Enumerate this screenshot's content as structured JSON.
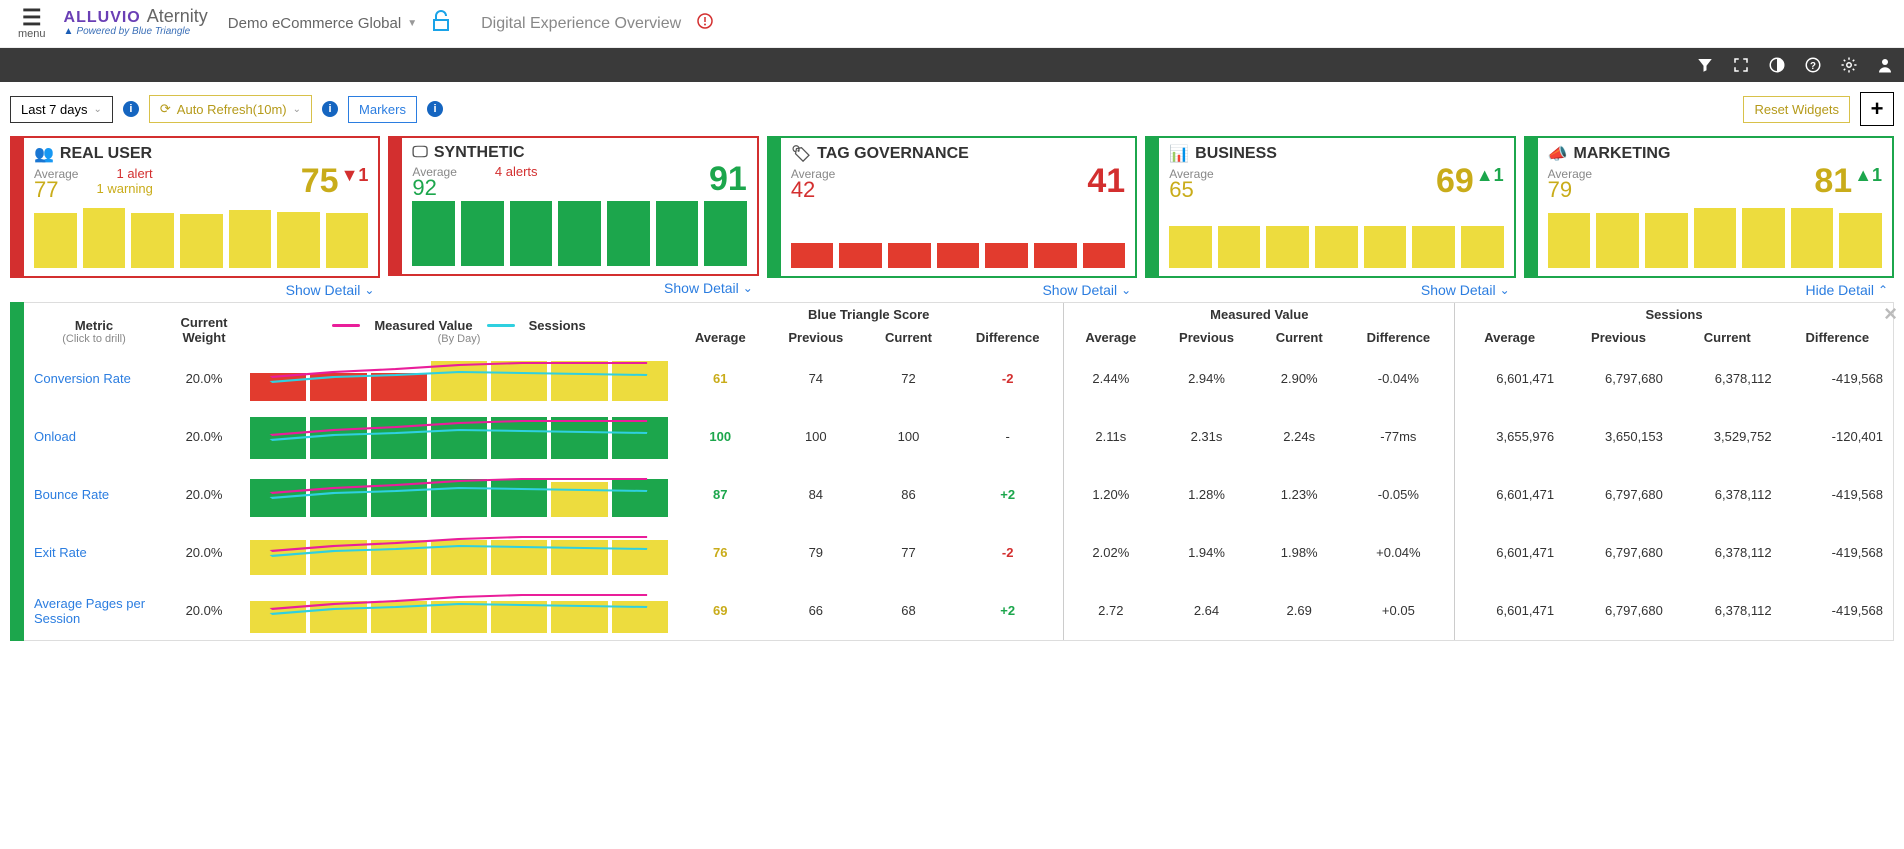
{
  "header": {
    "menu_label": "menu",
    "brand1": "ALLUVIO",
    "brand2": "Aternity",
    "powered": "Powered by Blue Triangle",
    "tenant": "Demo eCommerce Global",
    "page_title": "Digital Experience Overview"
  },
  "toolbar": {
    "daterange": "Last 7 days",
    "autorefresh": "Auto Refresh(10m)",
    "markers": "Markers",
    "reset": "Reset Widgets"
  },
  "cards": [
    {
      "id": "realuser",
      "title": "REAL USER",
      "icon": "users",
      "border": "red",
      "avgLabel": "Average",
      "avgVal": "77",
      "avgClass": "y",
      "alert": "1 alert",
      "warn": "1 warning",
      "bigVal": "75",
      "bigClass": "y",
      "trend": "▼1",
      "trendClass": "trend-dn r",
      "bars": [
        55,
        60,
        55,
        54,
        58,
        56,
        55
      ],
      "barClass": "y",
      "link": "Show Detail"
    },
    {
      "id": "synthetic",
      "title": "SYNTHETIC",
      "icon": "synth",
      "border": "red",
      "avgLabel": "Average",
      "avgVal": "92",
      "avgClass": "g",
      "alert": "4 alerts",
      "warn": "",
      "bigVal": "91",
      "bigClass": "g",
      "trend": "",
      "trendClass": "",
      "bars": [
        65,
        65,
        65,
        65,
        65,
        65,
        65
      ],
      "barClass": "g",
      "link": "Show Detail"
    },
    {
      "id": "tag",
      "title": "TAG GOVERNANCE",
      "icon": "tag",
      "border": "green",
      "avgLabel": "Average",
      "avgVal": "42",
      "avgClass": "r",
      "alert": "",
      "warn": "",
      "bigVal": "41",
      "bigClass": "r",
      "trend": "",
      "trendClass": "",
      "bars": [
        25,
        25,
        25,
        25,
        25,
        25,
        25
      ],
      "barClass": "r",
      "link": "Show Detail"
    },
    {
      "id": "business",
      "title": "BUSINESS",
      "icon": "biz",
      "border": "green",
      "avgLabel": "Average",
      "avgVal": "65",
      "avgClass": "y",
      "alert": "",
      "warn": "",
      "bigVal": "69",
      "bigClass": "y",
      "trend": "▲1",
      "trendClass": "trend-up g",
      "bars": [
        42,
        42,
        42,
        42,
        42,
        42,
        42
      ],
      "barClass": "y",
      "link": "Show Detail"
    },
    {
      "id": "marketing",
      "title": "MARKETING",
      "icon": "mkt",
      "border": "green",
      "avgLabel": "Average",
      "avgVal": "79",
      "avgClass": "y",
      "alert": "",
      "warn": "",
      "bigVal": "81",
      "bigClass": "y",
      "trend": "▲1",
      "trendClass": "trend-up g",
      "bars": [
        55,
        55,
        55,
        60,
        60,
        60,
        55
      ],
      "barClass": "y",
      "link": "Hide Detail"
    }
  ],
  "detail": {
    "headers": {
      "metric": "Metric",
      "metric_hint": "(Click to drill)",
      "weight": "Current Weight",
      "chart_hint": "(By Day)",
      "legend_measured": "Measured Value",
      "legend_sessions": "Sessions",
      "groups": [
        "Blue Triangle Score",
        "Measured Value",
        "Sessions"
      ],
      "cols": [
        "Average",
        "Previous",
        "Current",
        "Difference"
      ]
    },
    "rows": [
      {
        "metric": "Conversion Rate",
        "weight": "20.0%",
        "bars": [
          {
            "h": 28,
            "c": "r"
          },
          {
            "h": 28,
            "c": "r"
          },
          {
            "h": 28,
            "c": "r"
          },
          {
            "h": 40,
            "c": "y"
          },
          {
            "h": 40,
            "c": "y"
          },
          {
            "h": 40,
            "c": "y"
          },
          {
            "h": 40,
            "c": "y"
          }
        ],
        "bt": {
          "avg": "61",
          "avgC": "y",
          "prev": "74",
          "cur": "72",
          "diff": "-2",
          "diffC": "neg"
        },
        "mv": {
          "avg": "2.44%",
          "prev": "2.94%",
          "cur": "2.90%",
          "diff": "-0.04%"
        },
        "ss": {
          "avg": "6,601,471",
          "prev": "6,797,680",
          "cur": "6,378,112",
          "diff": "-419,568"
        }
      },
      {
        "metric": "Onload",
        "weight": "20.0%",
        "bars": [
          {
            "h": 42,
            "c": "g"
          },
          {
            "h": 42,
            "c": "g"
          },
          {
            "h": 42,
            "c": "g"
          },
          {
            "h": 42,
            "c": "g"
          },
          {
            "h": 42,
            "c": "g"
          },
          {
            "h": 42,
            "c": "g"
          },
          {
            "h": 42,
            "c": "g"
          }
        ],
        "bt": {
          "avg": "100",
          "avgC": "g",
          "prev": "100",
          "cur": "100",
          "diff": "-",
          "diffC": ""
        },
        "mv": {
          "avg": "2.11s",
          "prev": "2.31s",
          "cur": "2.24s",
          "diff": "-77ms"
        },
        "ss": {
          "avg": "3,655,976",
          "prev": "3,650,153",
          "cur": "3,529,752",
          "diff": "-120,401"
        }
      },
      {
        "metric": "Bounce Rate",
        "weight": "20.0%",
        "bars": [
          {
            "h": 38,
            "c": "g"
          },
          {
            "h": 38,
            "c": "g"
          },
          {
            "h": 38,
            "c": "g"
          },
          {
            "h": 38,
            "c": "g"
          },
          {
            "h": 38,
            "c": "g"
          },
          {
            "h": 35,
            "c": "y"
          },
          {
            "h": 38,
            "c": "g"
          }
        ],
        "bt": {
          "avg": "87",
          "avgC": "g",
          "prev": "84",
          "cur": "86",
          "diff": "+2",
          "diffC": "pos"
        },
        "mv": {
          "avg": "1.20%",
          "prev": "1.28%",
          "cur": "1.23%",
          "diff": "-0.05%"
        },
        "ss": {
          "avg": "6,601,471",
          "prev": "6,797,680",
          "cur": "6,378,112",
          "diff": "-419,568"
        }
      },
      {
        "metric": "Exit Rate",
        "weight": "20.0%",
        "bars": [
          {
            "h": 35,
            "c": "y"
          },
          {
            "h": 35,
            "c": "y"
          },
          {
            "h": 35,
            "c": "y"
          },
          {
            "h": 35,
            "c": "y"
          },
          {
            "h": 35,
            "c": "y"
          },
          {
            "h": 35,
            "c": "y"
          },
          {
            "h": 35,
            "c": "y"
          }
        ],
        "bt": {
          "avg": "76",
          "avgC": "y",
          "prev": "79",
          "cur": "77",
          "diff": "-2",
          "diffC": "neg"
        },
        "mv": {
          "avg": "2.02%",
          "prev": "1.94%",
          "cur": "1.98%",
          "diff": "+0.04%"
        },
        "ss": {
          "avg": "6,601,471",
          "prev": "6,797,680",
          "cur": "6,378,112",
          "diff": "-419,568"
        }
      },
      {
        "metric": "Average Pages per Session",
        "weight": "20.0%",
        "bars": [
          {
            "h": 32,
            "c": "y"
          },
          {
            "h": 32,
            "c": "y"
          },
          {
            "h": 32,
            "c": "y"
          },
          {
            "h": 32,
            "c": "y"
          },
          {
            "h": 32,
            "c": "y"
          },
          {
            "h": 32,
            "c": "y"
          },
          {
            "h": 32,
            "c": "y"
          }
        ],
        "bt": {
          "avg": "69",
          "avgC": "y",
          "prev": "66",
          "cur": "68",
          "diff": "+2",
          "diffC": "pos"
        },
        "mv": {
          "avg": "2.72",
          "prev": "2.64",
          "cur": "2.69",
          "diff": "+0.05"
        },
        "ss": {
          "avg": "6,601,471",
          "prev": "6,797,680",
          "cur": "6,378,112",
          "diff": "-419,568"
        }
      }
    ]
  },
  "chart_data": {
    "top_cards": [
      {
        "name": "REAL USER",
        "type": "bar",
        "values": [
          55,
          60,
          55,
          54,
          58,
          56,
          55
        ],
        "ylim": [
          0,
          100
        ],
        "color": "yellow"
      },
      {
        "name": "SYNTHETIC",
        "type": "bar",
        "values": [
          65,
          65,
          65,
          65,
          65,
          65,
          65
        ],
        "ylim": [
          0,
          100
        ],
        "color": "green"
      },
      {
        "name": "TAG GOVERNANCE",
        "type": "bar",
        "values": [
          25,
          25,
          25,
          25,
          25,
          25,
          25
        ],
        "ylim": [
          0,
          100
        ],
        "color": "red"
      },
      {
        "name": "BUSINESS",
        "type": "bar",
        "values": [
          42,
          42,
          42,
          42,
          42,
          42,
          42
        ],
        "ylim": [
          0,
          100
        ],
        "color": "yellow"
      },
      {
        "name": "MARKETING",
        "type": "bar",
        "values": [
          55,
          55,
          55,
          60,
          60,
          60,
          55
        ],
        "ylim": [
          0,
          100
        ],
        "color": "yellow"
      }
    ],
    "detail_rows_series": {
      "note": "Each row overlays two lines (Measured Value magenta, Sessions cyan) on bars. 7 daily points. Relative y only; no axis labels visible."
    }
  }
}
